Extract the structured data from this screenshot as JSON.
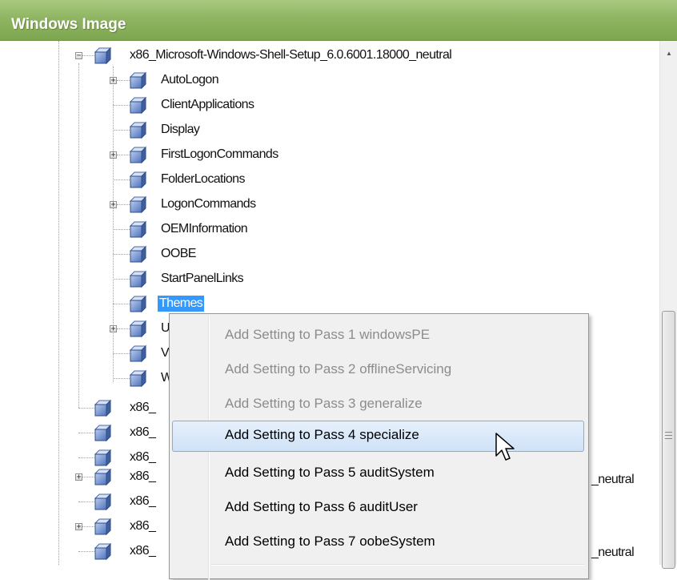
{
  "panel": {
    "title": "Windows Image"
  },
  "tree": {
    "root_label": "x86_Microsoft-Windows-Shell-Setup_6.0.6001.18000_neutral",
    "children": [
      "AutoLogon",
      "ClientApplications",
      "Display",
      "FirstLogonCommands",
      "FolderLocations",
      "LogonCommands",
      "OEMInformation",
      "OOBE",
      "StartPanelLinks",
      "Themes",
      "U",
      "V",
      "W"
    ],
    "siblings": [
      {
        "label": "x86_"
      },
      {
        "label": "x86_"
      },
      {
        "label": "x86_"
      },
      {
        "label": "x86_",
        "tail": "_neutral"
      },
      {
        "label": "x86_"
      },
      {
        "label": "x86_"
      },
      {
        "label": "x86_",
        "tail": "_neutral"
      }
    ]
  },
  "context_menu": {
    "items": [
      "Add Setting to Pass 1 windowsPE",
      "Add Setting to Pass 2 offlineServicing",
      "Add Setting to Pass 3 generalize",
      "Add Setting to Pass 4 specialize",
      "Add Setting to Pass 5 auditSystem",
      "Add Setting to Pass 6 auditUser",
      "Add Setting to Pass 7 oobeSystem"
    ]
  },
  "colors": {
    "header_green": "#8fb562",
    "selection_blue": "#3399ff",
    "menu_highlight": "#cfe2f8"
  }
}
